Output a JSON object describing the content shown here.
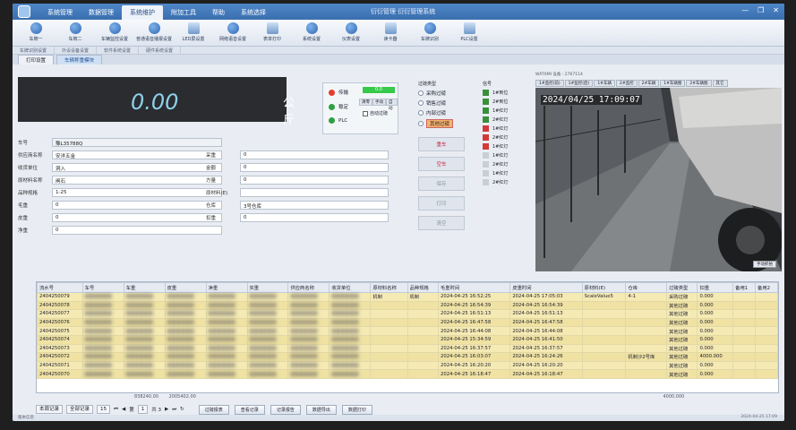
{
  "window": {
    "title": "衍衍管理  衍衍管理系统",
    "minimize": "—",
    "maximize": "❐",
    "close": "✕"
  },
  "menu": [
    "系统管理",
    "数据管理",
    "系统维护",
    "附加工具",
    "帮助",
    "系统选择"
  ],
  "menu_active_index": 2,
  "ribbon_items": [
    {
      "label": "车牌一",
      "icon": "camera-icon"
    },
    {
      "label": "车牌二",
      "icon": "camera-icon"
    },
    {
      "label": "车辆监控设置",
      "icon": "settings-icon"
    },
    {
      "label": "普通语音播报设置",
      "icon": "speaker-icon"
    },
    {
      "label": "LED屏设置",
      "icon": "led-icon"
    },
    {
      "label": "网络语音设置",
      "icon": "speaker-icon"
    },
    {
      "label": "表单打印",
      "icon": "print-icon"
    },
    {
      "label": "系统设置",
      "icon": "gear-icon"
    },
    {
      "label": "仪表设置",
      "icon": "gear-icon"
    },
    {
      "label": "读卡器",
      "icon": "card-icon"
    },
    {
      "label": "车牌识别",
      "icon": "camera-icon"
    },
    {
      "label": "PLC设置",
      "icon": "plc-icon"
    }
  ],
  "ribbon_groups": [
    "车牌识别设置",
    "外设设备设置",
    "软件系统设置",
    "硬件系统设置"
  ],
  "doc_tabs": [
    "打印设置",
    "车辆称重模块"
  ],
  "weight": {
    "value": "0.00",
    "unit": "公斤"
  },
  "status_lights": [
    {
      "label": "传输",
      "color": "red"
    },
    {
      "label": "稳定",
      "color": "green"
    },
    {
      "label": "PLC",
      "color": "green"
    }
  ],
  "status_box": "0.0",
  "mini_buttons": [
    "清零",
    "手动",
    "自动"
  ],
  "auto_checkbox": "自动过磅",
  "form_left": [
    {
      "label": "车号",
      "value": "豫L35788Q"
    },
    {
      "label": "供应商名称",
      "value": "安洋五金"
    },
    {
      "label": "收货单位",
      "value": "洞入"
    },
    {
      "label": "原材料名称",
      "value": "闸石"
    },
    {
      "label": "品种规格",
      "value": "1-25"
    },
    {
      "label": "毛重",
      "value": "0"
    },
    {
      "label": "皮重",
      "value": "0"
    },
    {
      "label": "净重",
      "value": "0"
    }
  ],
  "form_right": [
    {
      "label": "采重",
      "value": "0"
    },
    {
      "label": "金额",
      "value": "0"
    },
    {
      "label": "方量",
      "value": "0"
    },
    {
      "label": "原材料(E)",
      "value": ""
    },
    {
      "label": "仓库",
      "value": "3号仓库"
    },
    {
      "label": "扣重",
      "value": "0"
    }
  ],
  "weigh_type": {
    "title": "过磅类型",
    "options": [
      "采购过磅",
      "销售过磅",
      "内部过磅",
      "其他过磅"
    ],
    "selected": 3
  },
  "action_buttons": [
    "重车",
    "空车",
    "保存",
    "打印",
    "清空"
  ],
  "lamps_title": "信号",
  "lamps": [
    {
      "label": "1#到位",
      "color": "green"
    },
    {
      "label": "2#到位",
      "color": "green"
    },
    {
      "label": "1#红灯",
      "color": "green"
    },
    {
      "label": "2#红灯",
      "color": "green"
    },
    {
      "label": "1#红灯",
      "color": "red"
    },
    {
      "label": "2#红灯",
      "color": "red"
    },
    {
      "label": "1#红灯",
      "color": "red"
    },
    {
      "label": "1#红灯",
      "color": "gray"
    },
    {
      "label": "2#红灯",
      "color": "gray"
    },
    {
      "label": "1#红灯",
      "color": "gray"
    },
    {
      "label": "2#红灯",
      "color": "gray"
    }
  ],
  "camera": {
    "header": "WATXMI 设备 : 2767114",
    "tabs": [
      "1#监控(前)",
      "1#监控(后)",
      "1#车辆",
      "2#监控",
      "2#车辆",
      "1#车辆图",
      "2#车辆图",
      "其它"
    ],
    "timestamp": "2024/04/25 17:09:07",
    "capture_button": "手动抓拍"
  },
  "grid": {
    "columns": [
      "流水号",
      "车号",
      "车重",
      "皮重",
      "净重",
      "实重",
      "供应商名称",
      "收货单位",
      "原材料名称",
      "品种规格",
      "毛重时间",
      "皮重时间",
      "原材料(E)",
      "仓库",
      "过磅类型",
      "扣重",
      "备用1",
      "备用2"
    ],
    "rows": [
      [
        "2404250079",
        "",
        "",
        "",
        "",
        "",
        "",
        "",
        "机制",
        "机制",
        "2024-04-25 16:52:25",
        "2024-04-25 17:05:03",
        "ScaleValue5",
        "4-1",
        "采购过磅",
        "0.000",
        "",
        ""
      ],
      [
        "2404250078",
        "",
        "",
        "",
        "",
        "",
        "",
        "",
        "",
        "",
        "2024-04-25 16:54:39",
        "2024-04-25 16:54:39",
        "",
        "",
        "其他过磅",
        "0.000",
        "",
        ""
      ],
      [
        "2404250077",
        "",
        "",
        "",
        "",
        "",
        "",
        "",
        "",
        "",
        "2024-04-25 16:51:13",
        "2024-04-25 16:51:13",
        "",
        "",
        "其他过磅",
        "0.000",
        "",
        ""
      ],
      [
        "2404250076",
        "",
        "",
        "",
        "",
        "",
        "",
        "",
        "",
        "",
        "2024-04-25 16:47:58",
        "2024-04-25 16:47:58",
        "",
        "",
        "其他过磅",
        "0.000",
        "",
        ""
      ],
      [
        "2404250075",
        "",
        "",
        "",
        "",
        "",
        "",
        "",
        "",
        "",
        "2024-04-25 16:44:08",
        "2024-04-25 16:44:08",
        "",
        "",
        "其他过磅",
        "0.000",
        "",
        ""
      ],
      [
        "2404250074",
        "",
        "",
        "",
        "",
        "",
        "",
        "",
        "",
        "",
        "2024-04-25 15:34:59",
        "2024-04-25 16:41:50",
        "",
        "",
        "其他过磅",
        "0.000",
        "",
        ""
      ],
      [
        "2404250073",
        "",
        "",
        "",
        "",
        "",
        "",
        "",
        "",
        "",
        "2024-04-25 16:37:57",
        "2024-04-25 16:37:57",
        "",
        "",
        "其他过磅",
        "0.000",
        "",
        ""
      ],
      [
        "2404250072",
        "",
        "",
        "",
        "",
        "",
        "",
        "",
        "",
        "",
        "2024-04-25 16:03:07",
        "2024-04-25 16:24:26",
        "",
        "机制沙2号库",
        "其他过磅",
        "4000.000",
        "",
        ""
      ],
      [
        "2404250071",
        "",
        "",
        "",
        "",
        "",
        "",
        "",
        "",
        "",
        "2024-04-25 16:20:20",
        "2024-04-25 16:20:20",
        "",
        "",
        "其他过磅",
        "0.000",
        "",
        ""
      ],
      [
        "2404250070",
        "",
        "",
        "",
        "",
        "",
        "",
        "",
        "",
        "",
        "2024-04-25 16:18:47",
        "2024-04-25 16:18:47",
        "",
        "",
        "其他过磅",
        "0.000",
        "",
        ""
      ]
    ],
    "totals": [
      "838240.00",
      "2005402.00"
    ],
    "deduct_total": "4000.000"
  },
  "pager": {
    "filter": "本周记录",
    "scope": "全部记录",
    "page_size": "15",
    "page_prefix": "第",
    "page": "1",
    "page_total": "共 3",
    "first": "⏮",
    "prev": "◀",
    "next": "▶",
    "last": "⏭",
    "refresh": "↻",
    "buttons": [
      "过磅报表",
      "查看记录",
      "记录报告",
      "数据导出",
      "数据打印"
    ]
  },
  "statusbar": {
    "left": "版本信息",
    "right": "2024-04-25 17:09"
  }
}
